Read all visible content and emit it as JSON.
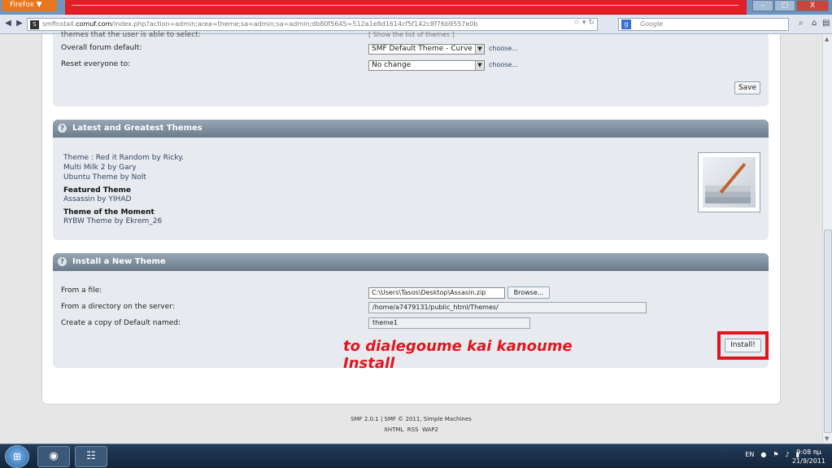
{
  "browser": {
    "menu_label": "Firefox ▼",
    "url_domain": "comuf.com",
    "url_prefix": "smfinstall.",
    "url_path": "/index.php?action=admin;area=theme;sa=admin;sa=admin;db80f5645=512a1e8d1614cf5f142c8f76b9557e0b",
    "search_placeholder": "Google",
    "window_buttons": [
      "–",
      "▢",
      "X"
    ]
  },
  "settings": {
    "partial_row": "themes that the user is able to select:",
    "partial_row_value": "[ Show the list of themes ]",
    "overall_default_label": "Overall forum default:",
    "overall_default_value": "SMF Default Theme - Curve",
    "reset_label": "Reset everyone to:",
    "reset_value": "No change",
    "choose_link": "choose...",
    "save_label": "Save"
  },
  "latest": {
    "header": "Latest and Greatest Themes",
    "links": [
      "Theme : Red it Random by Ricky.",
      "Multi Milk 2 by Gary",
      "Ubuntu Theme by Nolt"
    ],
    "featured_heading": "Featured Theme",
    "featured_link": "Assassin by YIHAD",
    "moment_heading": "Theme of the Moment",
    "moment_link": "RYBW Theme by Ekrem_26"
  },
  "install": {
    "header": "Install a New Theme",
    "from_file_label": "From a file:",
    "from_file_value": "C:\\Users\\Tasos\\Desktop\\Assasin.zip",
    "browse_label": "Browse...",
    "from_dir_label": "From a directory on the server:",
    "from_dir_value": "/home/a7479131/public_html/Themes/",
    "copy_label": "Create a copy of Default named:",
    "copy_value": "theme1",
    "install_label": "Install!"
  },
  "annotation": {
    "line1": "to dialegoume kai kanoume",
    "line2": "Install"
  },
  "footer": {
    "line1": "SMF 2.0.1 | SMF © 2011, Simple Machines",
    "links": [
      "XHTML",
      "RSS",
      "WAP2"
    ]
  },
  "taskbar": {
    "lang": "EN",
    "time": "9:08 πμ",
    "date": "21/9/2011"
  }
}
